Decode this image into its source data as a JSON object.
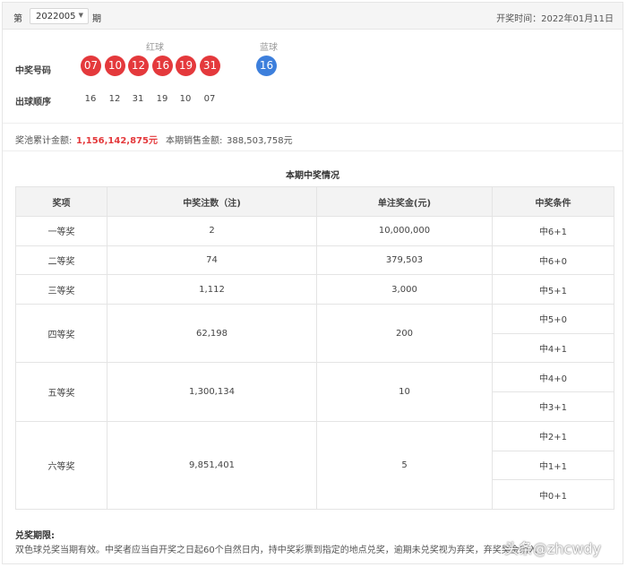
{
  "header": {
    "prefix": "第",
    "issue": "2022005",
    "suffix": "期",
    "draw_time": "开奖时间：2022年01月11日"
  },
  "draw": {
    "red_label": "红球",
    "blue_label": "蓝球",
    "win_label": "中奖号码",
    "red_balls": [
      "07",
      "10",
      "12",
      "16",
      "19",
      "31"
    ],
    "blue_ball": "16",
    "order_label": "出球顺序",
    "order": [
      "16",
      "12",
      "31",
      "19",
      "10",
      "07"
    ]
  },
  "pool": {
    "pool_label": "奖池累计金额:",
    "pool_value": "1,156,142,875元",
    "sales_label": "本期销售金额:",
    "sales_value": "388,503,758元"
  },
  "table_title": "本期中奖情况",
  "table": {
    "headers": [
      "奖项",
      "中奖注数（注)",
      "单注奖金(元)",
      "中奖条件"
    ],
    "rows": [
      {
        "prize": "一等奖",
        "count": "2",
        "amount": "10,000,000",
        "conds": [
          "中6+1"
        ]
      },
      {
        "prize": "二等奖",
        "count": "74",
        "amount": "379,503",
        "conds": [
          "中6+0"
        ]
      },
      {
        "prize": "三等奖",
        "count": "1,112",
        "amount": "3,000",
        "conds": [
          "中5+1"
        ]
      },
      {
        "prize": "四等奖",
        "count": "62,198",
        "amount": "200",
        "conds": [
          "中5+0",
          "中4+1"
        ]
      },
      {
        "prize": "五等奖",
        "count": "1,300,134",
        "amount": "10",
        "conds": [
          "中4+0",
          "中3+1"
        ]
      },
      {
        "prize": "六等奖",
        "count": "9,851,401",
        "amount": "5",
        "conds": [
          "中2+1",
          "中1+1",
          "中0+1"
        ]
      }
    ]
  },
  "notes": {
    "title": "兑奖期限:",
    "body": "双色球兑奖当期有效。中奖者应当自开奖之日起60个自然日内，持中奖彩票到指定的地点兑奖，逾期未兑奖视为弃奖，弃奖奖金纳入"
  },
  "watermark": "头条@zhcwdy",
  "colors": {
    "red_ball": "#e4393c",
    "blue_ball": "#3d7fdc",
    "pool_value": "#e4393c"
  }
}
